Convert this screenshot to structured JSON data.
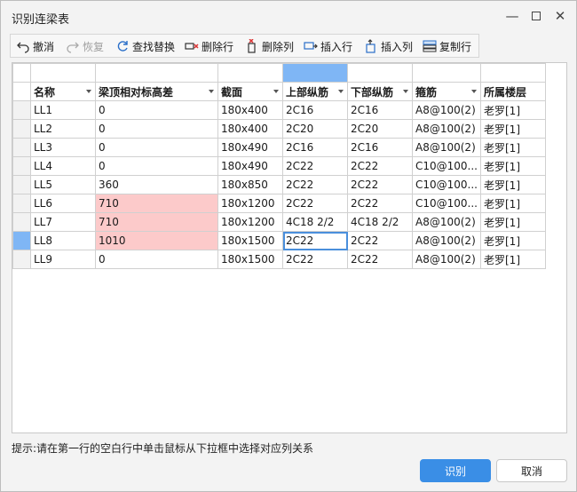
{
  "window": {
    "title": "识别连梁表"
  },
  "toolbar": {
    "undo": "撤消",
    "redo": "恢复",
    "find_replace": "查找替换",
    "delete_row": "删除行",
    "delete_col": "删除列",
    "insert_row": "插入行",
    "insert_col": "插入列",
    "copy_row": "复制行"
  },
  "table": {
    "headers": [
      "名称",
      "梁顶相对标高差",
      "截面",
      "上部纵筋",
      "下部纵筋",
      "箍筋",
      "所属楼层"
    ],
    "rows": [
      [
        "LL1",
        "0",
        "180x400",
        "2C16",
        "2C16",
        "A8@100(2)",
        "老罗[1]"
      ],
      [
        "LL2",
        "0",
        "180x400",
        "2C20",
        "2C20",
        "A8@100(2)",
        "老罗[1]"
      ],
      [
        "LL3",
        "0",
        "180x490",
        "2C16",
        "2C16",
        "A8@100(2)",
        "老罗[1]"
      ],
      [
        "LL4",
        "0",
        "180x490",
        "2C22",
        "2C22",
        "C10@100...",
        "老罗[1]"
      ],
      [
        "LL5",
        "360",
        "180x850",
        "2C22",
        "2C22",
        "C10@100...",
        "老罗[1]"
      ],
      [
        "LL6",
        "710",
        "180x1200",
        "2C22",
        "2C22",
        "C10@100...",
        "老罗[1]"
      ],
      [
        "LL7",
        "710",
        "180x1200",
        "4C18 2/2",
        "4C18 2/2",
        "A8@100(2)",
        "老罗[1]"
      ],
      [
        "LL8",
        "1010",
        "180x1500",
        "2C22",
        "2C22",
        "A8@100(2)",
        "老罗[1]"
      ],
      [
        "LL9",
        "0",
        "180x1500",
        "2C22",
        "2C22",
        "A8@100(2)",
        "老罗[1]"
      ]
    ]
  },
  "hint": "提示:请在第一行的空白行中单击鼠标从下拉框中选择对应列关系",
  "buttons": {
    "ok": "识别",
    "cancel": "取消"
  },
  "colors": {
    "accent": "#3a8ee6",
    "selection": "#7fb6f5",
    "highlight": "#fccaca"
  }
}
